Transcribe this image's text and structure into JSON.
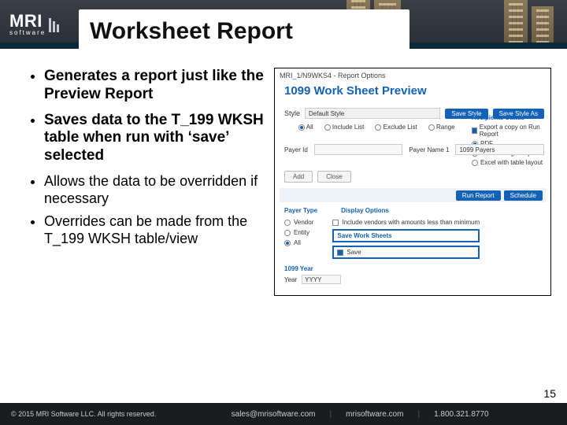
{
  "brand": {
    "name": "MRI",
    "tag": "software"
  },
  "title": "Worksheet Report",
  "bullets": [
    "Generates a report just like the Preview Report",
    "Saves data to the T_199 WKSH table when run with ‘save’ selected"
  ],
  "sub_bullets": [
    "Allows the data to be overridden if necessary",
    "Overrides can be made from the T_199 WKSH table/view"
  ],
  "shot": {
    "titlebar": "MRI_1/N9WKS4 - Report Options",
    "heading": "1099 Work Sheet Preview",
    "style_label": "Style",
    "style_value": "Default Style",
    "btn_save_style": "Save Style",
    "btn_save_as": "Save Style As",
    "opts": {
      "all": "All",
      "include": "Include List",
      "exclude": "Exclude List",
      "range": "Range"
    },
    "recipients_hdr": "Recipients Status",
    "recipients_note": "Export a copy on Run Report",
    "rec_pdf": "PDF",
    "rec_grid": "Excel with grid layout",
    "rec_table": "Excel with table layout",
    "payer_id_label": "Payer Id",
    "payer_name_label": "Payer Name 1",
    "payer_name_value": "1099 Payers",
    "btn_add": "Add",
    "btn_close": "Close",
    "btn_run": "Run Report",
    "btn_schedule": "Schedule",
    "payer_type_hdr": "Payer Type",
    "display_hdr": "Display Options",
    "pt_vendor": "Vendor",
    "pt_entity": "Entity",
    "pt_all": "All",
    "disp_option": "Include vendors with amounts less than minimum",
    "save_ws_hdr": "Save Work Sheets",
    "save_ws": "Save",
    "year_hdr": "1099 Year",
    "year_label": "Year",
    "year_value": "YYYY"
  },
  "footer": {
    "copyright": "© 2015 MRI Software LLC. All rights reserved.",
    "email": "sales@mrisoftware.com",
    "site": "mrisoftware.com",
    "phone": "1.800.321.8770"
  },
  "page_number": "15"
}
